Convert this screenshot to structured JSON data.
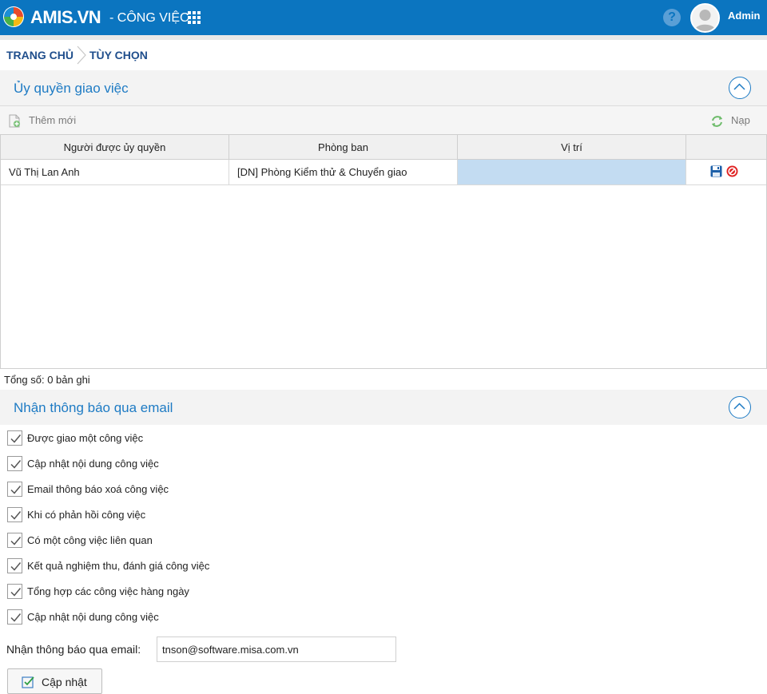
{
  "header": {
    "brand": "AMIS.VN",
    "module": "- CÔNG VIỆC",
    "username": "Admin",
    "help_glyph": "?",
    "icons": {
      "logo": "amis-logo-icon",
      "apps": "grid-icon",
      "help": "help-icon",
      "avatar": "user-avatar-icon"
    },
    "colors": {
      "bar": "#0b75c0",
      "accent": "#1e7bc4"
    }
  },
  "breadcrumb": {
    "home": "TRANG CHỦ",
    "current": "TÙY CHỌN"
  },
  "delegation": {
    "title": "Ủy quyền giao việc",
    "toolbar": {
      "add_label": "Thêm mới",
      "reload_label": "Nạp"
    },
    "columns": [
      "Người được ủy quyền",
      "Phòng ban",
      "Vị trí",
      ""
    ],
    "rows": [
      {
        "person": "Vũ Thị Lan Anh",
        "department": "[DN] Phòng Kiểm thử & Chuyển giao",
        "position": ""
      }
    ],
    "total": "Tổng số: 0 bản ghi"
  },
  "notifications": {
    "title": "Nhận thông báo qua email",
    "options": [
      {
        "label": "Được giao một công việc",
        "checked": true
      },
      {
        "label": "Cập nhật nội dung công việc",
        "checked": true
      },
      {
        "label": "Email thông báo xoá công việc",
        "checked": true
      },
      {
        "label": "Khi có phản hồi công việc",
        "checked": true
      },
      {
        "label": "Có một công việc liên quan",
        "checked": true
      },
      {
        "label": "Kết quả nghiệm thu, đánh giá công việc",
        "checked": true
      },
      {
        "label": "Tổng hợp các công việc hàng ngày",
        "checked": true
      },
      {
        "label": "Cập nhật nội dung công việc",
        "checked": true
      }
    ],
    "email_label": "Nhận thông báo qua email:",
    "email_value": "tnson@software.misa.com.vn",
    "update_label": "Cập nhật"
  }
}
